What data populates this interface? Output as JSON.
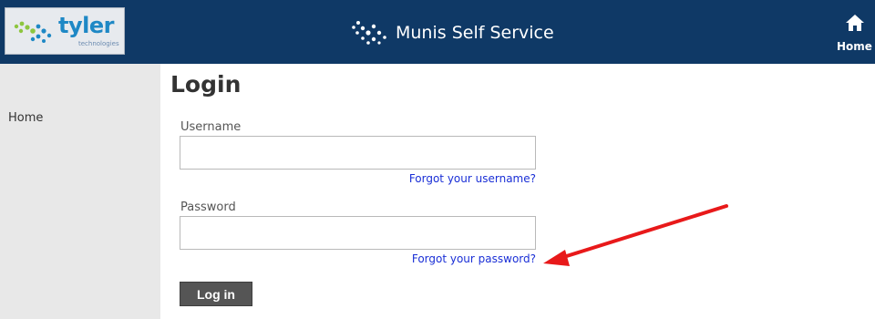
{
  "header": {
    "logo": {
      "wordmark": "tyler",
      "subtext": "technologies"
    },
    "app_title": "Munis Self Service",
    "home_label": "Home"
  },
  "sidebar": {
    "items": [
      {
        "label": "Home"
      }
    ]
  },
  "login": {
    "title": "Login",
    "username": {
      "label": "Username",
      "value": "",
      "placeholder": ""
    },
    "forgot_username": "Forgot your username?",
    "password": {
      "label": "Password",
      "value": "",
      "placeholder": ""
    },
    "forgot_password": "Forgot your password?",
    "submit_label": "Log in"
  },
  "annotation": {
    "color": "#e8191a"
  },
  "colors": {
    "header_bg": "#0f3966",
    "sidebar_bg": "#e8e8e8",
    "link": "#1a2fd6",
    "button_bg": "#555555"
  }
}
